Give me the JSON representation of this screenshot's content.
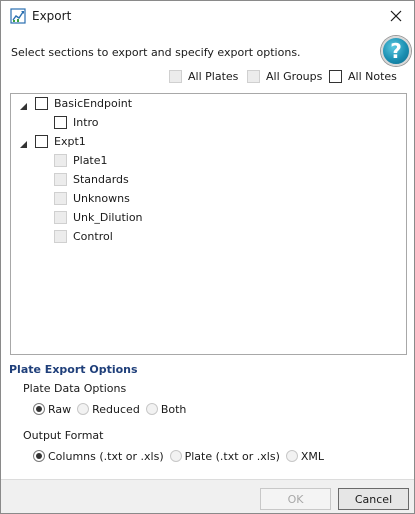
{
  "window": {
    "title": "Export",
    "app_icon": "export-chart-icon",
    "close_icon": "close-icon"
  },
  "instructions": "Select sections to export and specify export options.",
  "help": {
    "label": "?",
    "icon": "help-icon"
  },
  "top_options": [
    {
      "label": "All Plates",
      "checked": false,
      "enabled": false
    },
    {
      "label": "All Groups",
      "checked": false,
      "enabled": false
    },
    {
      "label": "All Notes",
      "checked": false,
      "enabled": true
    }
  ],
  "tree": [
    {
      "label": "BasicEndpoint",
      "level": 0,
      "expanded": true,
      "enabled": true,
      "checked": false
    },
    {
      "label": "Intro",
      "level": 1,
      "enabled": true,
      "checked": false
    },
    {
      "label": "Expt1",
      "level": 0,
      "expanded": true,
      "enabled": true,
      "checked": false
    },
    {
      "label": "Plate1",
      "level": 1,
      "enabled": false,
      "checked": false
    },
    {
      "label": "Standards",
      "level": 1,
      "enabled": false,
      "checked": false
    },
    {
      "label": "Unknowns",
      "level": 1,
      "enabled": false,
      "checked": false
    },
    {
      "label": "Unk_Dilution",
      "level": 1,
      "enabled": false,
      "checked": false
    },
    {
      "label": "Control",
      "level": 1,
      "enabled": false,
      "checked": false
    }
  ],
  "plate_export": {
    "section_title": "Plate Export Options",
    "plate_data": {
      "label": "Plate Data Options",
      "options": [
        {
          "label": "Raw",
          "selected": true
        },
        {
          "label": "Reduced",
          "selected": false
        },
        {
          "label": "Both",
          "selected": false
        }
      ]
    },
    "output_format": {
      "label": "Output Format",
      "options": [
        {
          "label": "Columns (.txt or .xls)",
          "selected": true
        },
        {
          "label": "Plate (.txt or .xls)",
          "selected": false
        },
        {
          "label": "XML",
          "selected": false
        }
      ]
    }
  },
  "buttons": {
    "ok_label": "OK",
    "ok_enabled": false,
    "cancel_label": "Cancel"
  },
  "colors": {
    "section_title": "#1f3f7a",
    "help_button": "#1a8fb2",
    "footer_bg": "#f0f0f0"
  }
}
